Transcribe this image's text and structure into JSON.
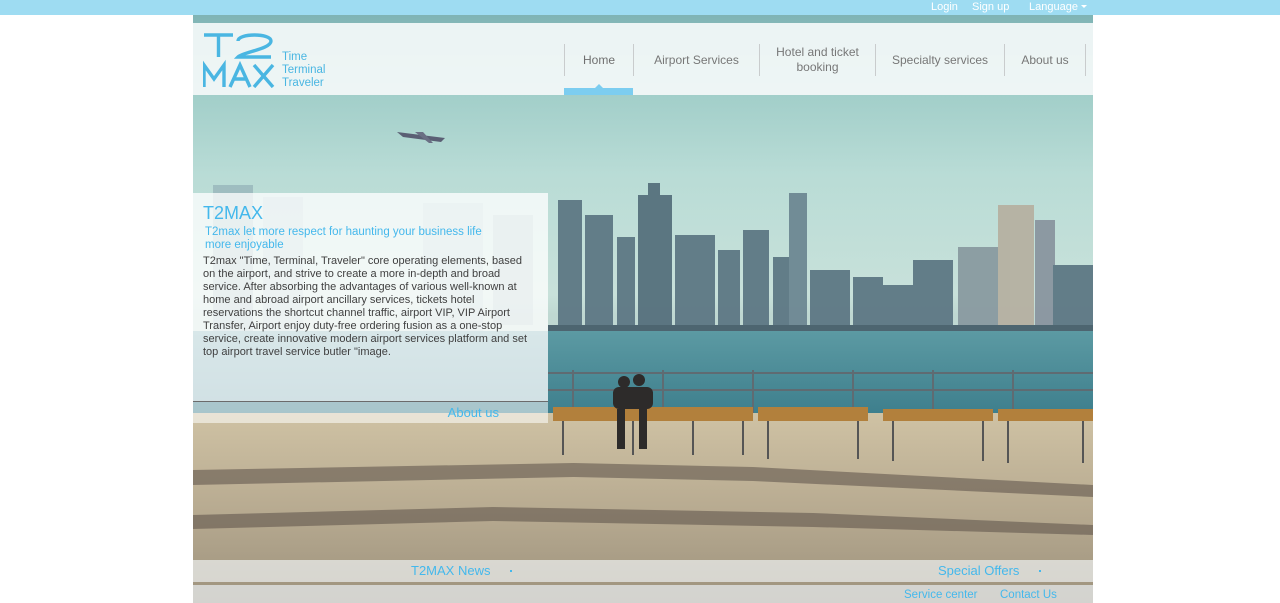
{
  "topbar": {
    "login": "Login",
    "signup": "Sign up",
    "language": "Language"
  },
  "logo": {
    "mark_top": "T2",
    "mark_bottom": "MAX",
    "words": [
      "Time",
      "Terminal",
      "Traveler"
    ]
  },
  "nav": {
    "items": [
      {
        "label": "Home",
        "active": true
      },
      {
        "label": "Airport Services"
      },
      {
        "label": "Hotel and ticket booking"
      },
      {
        "label": "Specialty services"
      },
      {
        "label": "About us"
      }
    ]
  },
  "intro": {
    "title": "T2MAX",
    "tagline": "T2max let more respect for haunting your business life more enjoyable",
    "body": "T2max \"Time, Terminal, Traveler\" core operating elements, based on the airport, and strive to create a more in-depth and broad service. After absorbing the advantages of various well-known at home and abroad airport ancillary services, tickets hotel reservations the shortcut channel traffic, airport VIP, VIP Airport Transfer, Airport enjoy duty-free ordering fusion as a one-stop service, create innovative modern airport services platform and set top airport travel service butler \"image.",
    "about_link": "About us"
  },
  "bottom": {
    "news": "T2MAX News",
    "offers": "Special Offers",
    "service_center": "Service center",
    "contact_us": "Contact Us"
  },
  "colors": {
    "accent": "#44b8ec",
    "topbar": "#9edcf2",
    "nav_indicator": "#7ccdf0"
  }
}
